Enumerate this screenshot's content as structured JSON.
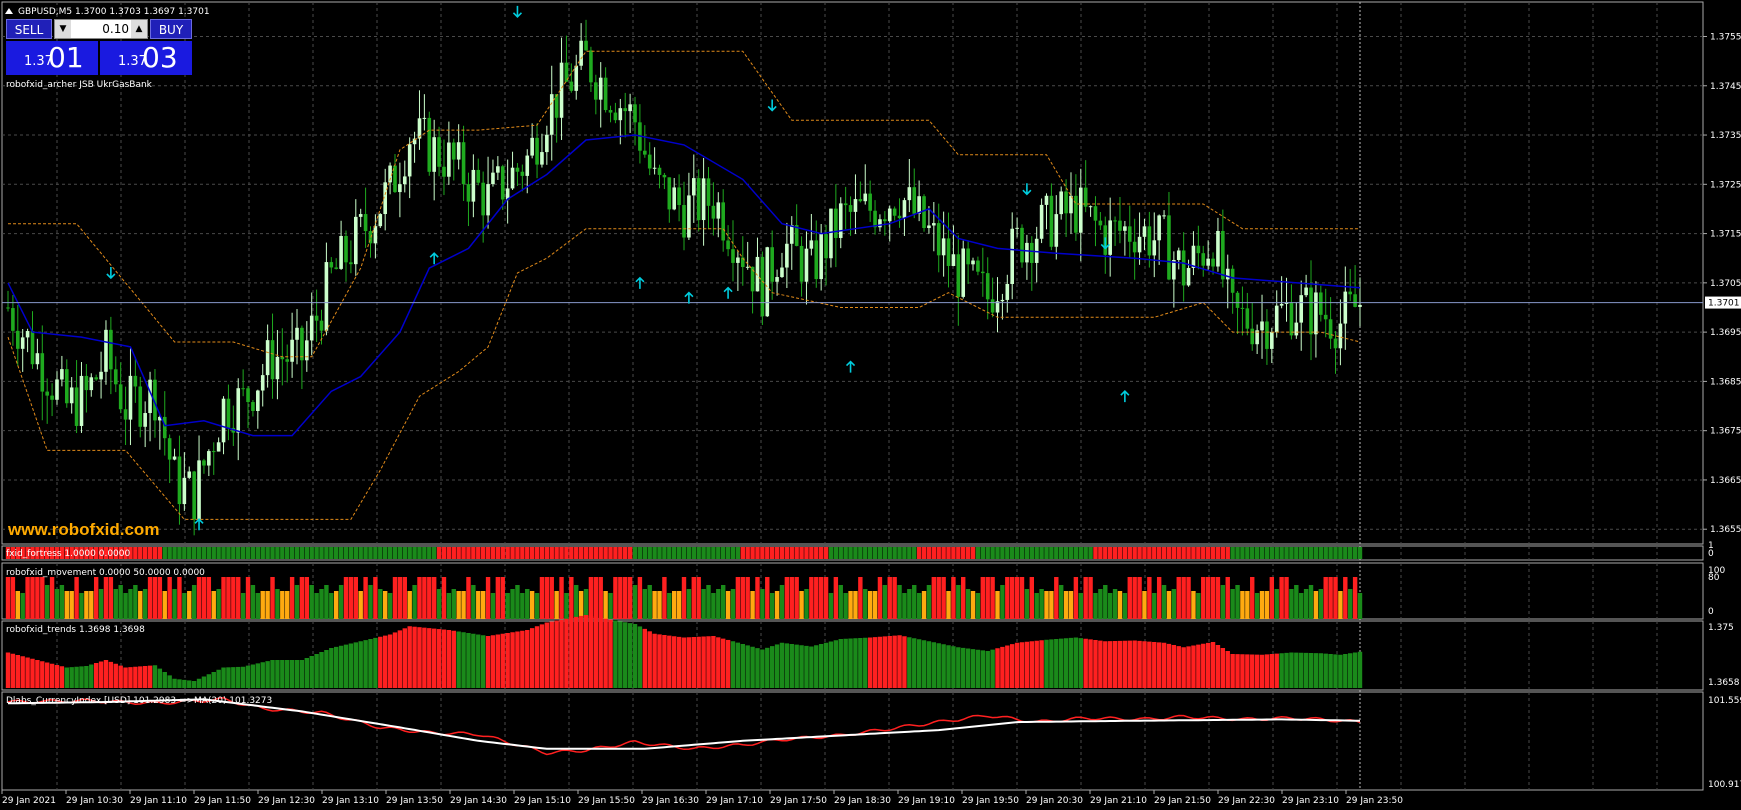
{
  "header": {
    "symbol_line": "GBPUSD,M5  1.3700 1.3703 1.3697 1.3701",
    "indicator_label": "robofxid_archer JSB UkrGasBank",
    "watermark": "www.robofxid.com"
  },
  "trade_panel": {
    "sell_label": "SELL",
    "buy_label": "BUY",
    "lot": "0.10",
    "sell_prefix": "1.37",
    "sell_big": "01",
    "buy_prefix": "1.37",
    "buy_big": "03",
    "down_arrow": "▼",
    "up_arrow": "▲"
  },
  "colors": {
    "background": "#000000",
    "grid": "#4a4a4a",
    "bull_candle": "#ccffcc",
    "bear_candle": "#1faa1f",
    "blue_line": "#0000cc",
    "channel": "#e08a1a",
    "arrow": "#00ccdd",
    "red_bar": "#ff2020",
    "green_bar": "#1a8a1a",
    "orange_bar": "#ffaa10",
    "usd_index": "#ff2020",
    "usd_ma": "#ffffff",
    "watermark": "#ffaa00"
  },
  "chart_data": [
    {
      "name": "main",
      "type": "candlestick",
      "symbol": "GBPUSD",
      "timeframe": "M5",
      "ylim": [
        1.3652,
        1.3762
      ],
      "y_ticks": [
        "1.3755",
        "1.3745",
        "1.3735",
        "1.3725",
        "1.3715",
        "1.3705",
        "1.3695",
        "1.3685",
        "1.3675",
        "1.3665",
        "1.3655"
      ],
      "current_price": "1.3701",
      "x_ticks": [
        "29 Jan 2021",
        "29 Jan 10:30",
        "29 Jan 11:10",
        "29 Jan 11:50",
        "29 Jan 12:30",
        "29 Jan 13:10",
        "29 Jan 13:50",
        "29 Jan 14:30",
        "29 Jan 15:10",
        "29 Jan 15:50",
        "29 Jan 16:30",
        "29 Jan 17:10",
        "29 Jan 17:50",
        "29 Jan 18:30",
        "29 Jan 19:10",
        "29 Jan 19:50",
        "29 Jan 20:30",
        "29 Jan 21:10",
        "29 Jan 21:50",
        "29 Jan 22:30",
        "29 Jan 23:10",
        "29 Jan 23:50"
      ],
      "close_path": [
        [
          0,
          1.37
        ],
        [
          6,
          1.369
        ],
        [
          12,
          1.368
        ],
        [
          16,
          1.3682
        ],
        [
          20,
          1.369
        ],
        [
          24,
          1.368
        ],
        [
          30,
          1.3683
        ],
        [
          34,
          1.3665
        ],
        [
          38,
          1.3662
        ],
        [
          44,
          1.368
        ],
        [
          48,
          1.3681
        ],
        [
          54,
          1.369
        ],
        [
          60,
          1.369
        ],
        [
          66,
          1.3706
        ],
        [
          72,
          1.3715
        ],
        [
          78,
          1.3724
        ],
        [
          82,
          1.3735
        ],
        [
          90,
          1.373
        ],
        [
          98,
          1.3722
        ],
        [
          106,
          1.373
        ],
        [
          110,
          1.374
        ],
        [
          114,
          1.3745
        ],
        [
          118,
          1.375
        ],
        [
          122,
          1.3745
        ],
        [
          128,
          1.3738
        ],
        [
          132,
          1.3725
        ],
        [
          138,
          1.372
        ],
        [
          144,
          1.3722
        ],
        [
          148,
          1.3715
        ],
        [
          154,
          1.3704
        ],
        [
          158,
          1.3713
        ],
        [
          164,
          1.3708
        ],
        [
          170,
          1.3718
        ],
        [
          176,
          1.372
        ],
        [
          182,
          1.3723
        ],
        [
          188,
          1.3715
        ],
        [
          194,
          1.3707
        ],
        [
          200,
          1.3702
        ],
        [
          206,
          1.3713
        ],
        [
          212,
          1.3717
        ],
        [
          218,
          1.372
        ],
        [
          224,
          1.3715
        ],
        [
          230,
          1.3716
        ],
        [
          236,
          1.3713
        ],
        [
          240,
          1.3707
        ],
        [
          246,
          1.3714
        ],
        [
          250,
          1.3698
        ],
        [
          256,
          1.3697
        ],
        [
          262,
          1.37
        ],
        [
          268,
          1.3699
        ],
        [
          272,
          1.3697
        ],
        [
          276,
          1.3701
        ]
      ],
      "blue_line": [
        [
          0,
          1.3705
        ],
        [
          5,
          1.3695
        ],
        [
          15,
          1.3694
        ],
        [
          25,
          1.3692
        ],
        [
          32,
          1.3676
        ],
        [
          40,
          1.3677
        ],
        [
          50,
          1.3674
        ],
        [
          58,
          1.3674
        ],
        [
          66,
          1.3683
        ],
        [
          72,
          1.3686
        ],
        [
          80,
          1.3695
        ],
        [
          86,
          1.3708
        ],
        [
          94,
          1.3712
        ],
        [
          102,
          1.3722
        ],
        [
          110,
          1.3727
        ],
        [
          118,
          1.3734
        ],
        [
          128,
          1.3735
        ],
        [
          138,
          1.3733
        ],
        [
          150,
          1.3726
        ],
        [
          158,
          1.3717
        ],
        [
          166,
          1.3715
        ],
        [
          180,
          1.3717
        ],
        [
          188,
          1.372
        ],
        [
          194,
          1.3714
        ],
        [
          202,
          1.3712
        ],
        [
          214,
          1.3711
        ],
        [
          230,
          1.371
        ],
        [
          240,
          1.3709
        ],
        [
          250,
          1.3706
        ],
        [
          276,
          1.3704
        ]
      ],
      "channel_upper": [
        [
          0,
          1.3717
        ],
        [
          14,
          1.3717
        ],
        [
          24,
          1.3705
        ],
        [
          34,
          1.3693
        ],
        [
          46,
          1.3693
        ],
        [
          56,
          1.369
        ],
        [
          62,
          1.369
        ],
        [
          72,
          1.3708
        ],
        [
          80,
          1.3732
        ],
        [
          86,
          1.3736
        ],
        [
          96,
          1.3736
        ],
        [
          108,
          1.3737
        ],
        [
          118,
          1.3752
        ],
        [
          128,
          1.3752
        ],
        [
          150,
          1.3752
        ],
        [
          160,
          1.3738
        ],
        [
          188,
          1.3738
        ],
        [
          194,
          1.3731
        ],
        [
          212,
          1.3731
        ],
        [
          218,
          1.3721
        ],
        [
          244,
          1.3721
        ],
        [
          252,
          1.3716
        ],
        [
          276,
          1.3716
        ]
      ],
      "channel_lower": [
        [
          0,
          1.3694
        ],
        [
          8,
          1.3671
        ],
        [
          24,
          1.3671
        ],
        [
          36,
          1.3657
        ],
        [
          58,
          1.3657
        ],
        [
          70,
          1.3657
        ],
        [
          76,
          1.3667
        ],
        [
          84,
          1.3682
        ],
        [
          92,
          1.3687
        ],
        [
          98,
          1.3692
        ],
        [
          104,
          1.3707
        ],
        [
          110,
          1.371
        ],
        [
          118,
          1.3716
        ],
        [
          132,
          1.3716
        ],
        [
          146,
          1.3716
        ],
        [
          150,
          1.371
        ],
        [
          156,
          1.3703
        ],
        [
          170,
          1.37
        ],
        [
          186,
          1.37
        ],
        [
          192,
          1.3703
        ],
        [
          202,
          1.3698
        ],
        [
          234,
          1.3698
        ],
        [
          244,
          1.3701
        ],
        [
          250,
          1.3695
        ],
        [
          268,
          1.3695
        ],
        [
          276,
          1.3693
        ]
      ],
      "arrows_down": [
        [
          21,
          1.3707
        ],
        [
          104,
          1.376
        ],
        [
          156,
          1.3741
        ],
        [
          208,
          1.3724
        ],
        [
          224,
          1.3713
        ]
      ],
      "arrows_up": [
        [
          39,
          1.3656
        ],
        [
          87,
          1.371
        ],
        [
          129,
          1.3705
        ],
        [
          139,
          1.3702
        ],
        [
          147,
          1.3703
        ],
        [
          172,
          1.3688
        ],
        [
          228,
          1.3682
        ]
      ]
    },
    {
      "name": "fxid_fortress",
      "label": "fxid_fortress 1.0000 0.0000",
      "y_ticks": [
        "0",
        "1"
      ],
      "segments": [
        [
          "red",
          0,
          32
        ],
        [
          "green",
          32,
          88
        ],
        [
          "red",
          88,
          128
        ],
        [
          "green",
          128,
          150
        ],
        [
          "red",
          150,
          168
        ],
        [
          "green",
          168,
          186
        ],
        [
          "red",
          186,
          198
        ],
        [
          "green",
          198,
          222
        ],
        [
          "red",
          222,
          250
        ],
        [
          "green",
          250,
          276
        ]
      ]
    },
    {
      "name": "robofxid_movement",
      "label": "robofxid_movement 0.0000 50.0000 0.0000",
      "y_ticks": [
        "100",
        "80",
        "0"
      ],
      "pattern": [
        "red",
        "red",
        "orange",
        "green",
        "red",
        "green",
        "orange",
        "red",
        "green",
        "green",
        "orange",
        "red",
        "green",
        "red",
        "orange",
        "green",
        "red",
        "green",
        "red",
        "orange",
        "green",
        "green",
        "orange",
        "red",
        "red",
        "green",
        "orange",
        "green",
        "red",
        "orange",
        "green",
        "red"
      ]
    },
    {
      "name": "robofxid_trends",
      "label": "robofxid_trends 1.3698 1.3698",
      "y_ticks": [
        "1.375",
        "1.3658"
      ],
      "ylim": [
        1.3658,
        1.375
      ],
      "segments": [
        [
          "red",
          0,
          12
        ],
        [
          "green",
          12,
          18
        ],
        [
          "red",
          18,
          30
        ],
        [
          "green",
          30,
          76
        ],
        [
          "red",
          76,
          92
        ],
        [
          "green",
          92,
          98
        ],
        [
          "red",
          98,
          124
        ],
        [
          "green",
          124,
          130
        ],
        [
          "red",
          130,
          148
        ],
        [
          "green",
          148,
          176
        ],
        [
          "red",
          176,
          184
        ],
        [
          "green",
          184,
          202
        ],
        [
          "red",
          202,
          212
        ],
        [
          "green",
          212,
          220
        ],
        [
          "red",
          220,
          260
        ],
        [
          "green",
          260,
          276
        ]
      ]
    },
    {
      "name": "Dlabs_CurrencyIndex",
      "label": "Dlabs_CurrencyIndex [USD] 101.2983  =>MA(20) 101.3273",
      "y_ticks": [
        "101.5599",
        "100.9172"
      ],
      "ylim": [
        100.9172,
        101.5599
      ],
      "series": [
        {
          "name": "USD",
          "color": "red",
          "values": [
            [
              0,
              101.53
            ],
            [
              16,
              101.54
            ],
            [
              30,
              101.52
            ],
            [
              44,
              101.55
            ],
            [
              52,
              101.48
            ],
            [
              64,
              101.45
            ],
            [
              76,
              101.34
            ],
            [
              86,
              101.3
            ],
            [
              96,
              101.29
            ],
            [
              100,
              101.25
            ],
            [
              110,
              101.15
            ],
            [
              118,
              101.17
            ],
            [
              128,
              101.23
            ],
            [
              140,
              101.18
            ],
            [
              150,
              101.21
            ],
            [
              158,
              101.25
            ],
            [
              170,
              101.28
            ],
            [
              180,
              101.33
            ],
            [
              190,
              101.38
            ],
            [
              200,
              101.43
            ],
            [
              210,
              101.38
            ],
            [
              220,
              101.41
            ],
            [
              232,
              101.4
            ],
            [
              240,
              101.42
            ],
            [
              252,
              101.4
            ],
            [
              262,
              101.41
            ],
            [
              268,
              101.4
            ],
            [
              276,
              101.38
            ]
          ]
        },
        {
          "name": "MA(20)",
          "color": "white",
          "values": [
            [
              0,
              101.52
            ],
            [
              20,
              101.53
            ],
            [
              40,
              101.55
            ],
            [
              60,
              101.46
            ],
            [
              80,
              101.34
            ],
            [
              96,
              101.24
            ],
            [
              110,
              101.18
            ],
            [
              130,
              101.18
            ],
            [
              150,
              101.24
            ],
            [
              170,
              101.28
            ],
            [
              190,
              101.32
            ],
            [
              206,
              101.38
            ],
            [
              230,
              101.39
            ],
            [
              260,
              101.4
            ],
            [
              276,
              101.39
            ]
          ]
        }
      ]
    }
  ]
}
